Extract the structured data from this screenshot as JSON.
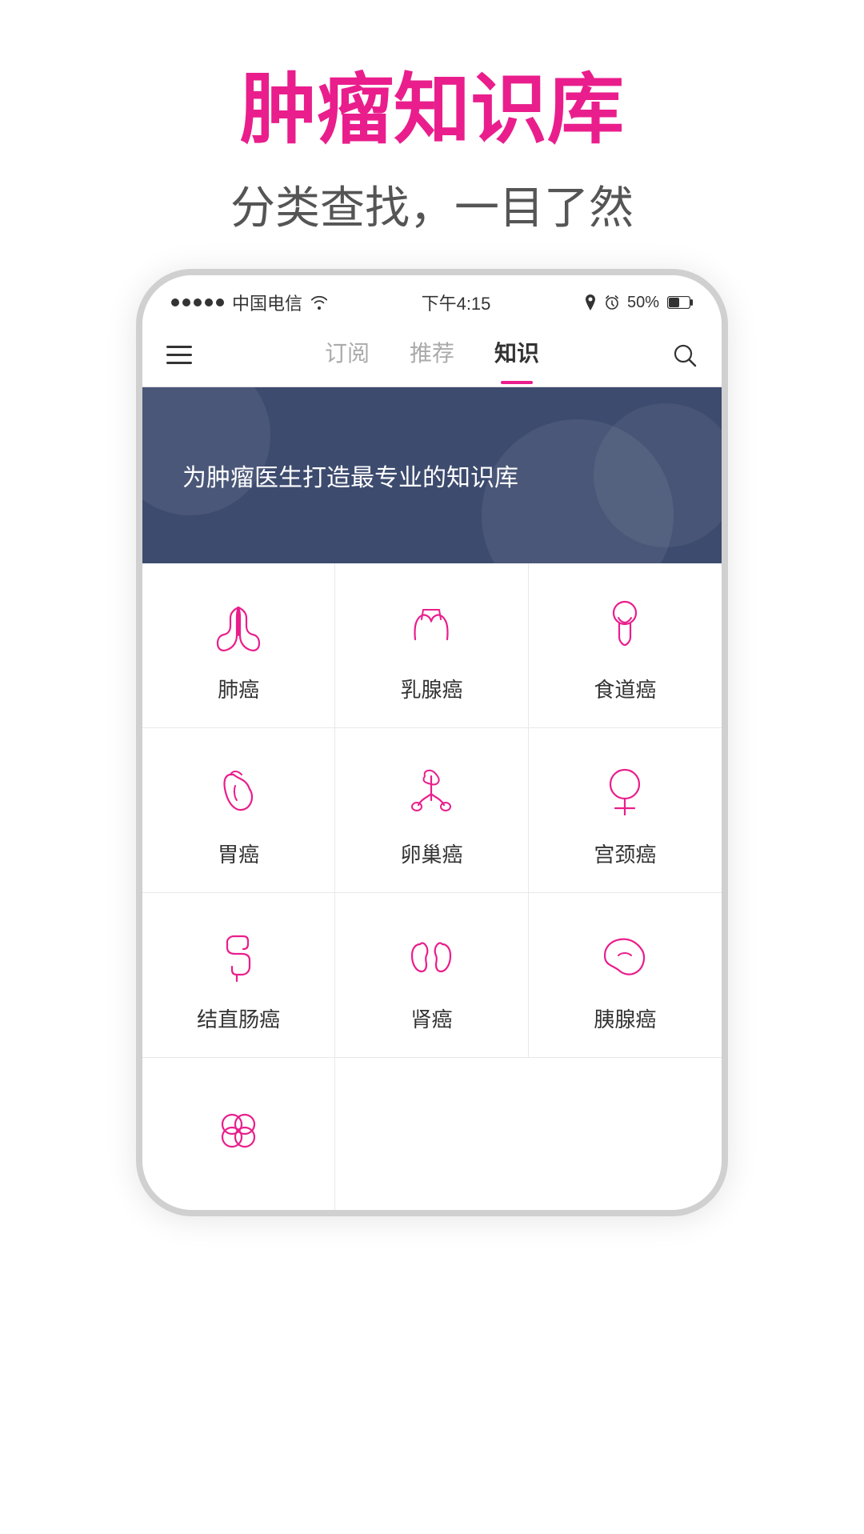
{
  "page": {
    "title_main": "肿瘤知识库",
    "title_sub": "分类查找，一目了然"
  },
  "status_bar": {
    "carrier": "中国电信",
    "time": "下午4:15",
    "battery": "50%"
  },
  "nav": {
    "tabs": [
      {
        "label": "订阅",
        "active": false
      },
      {
        "label": "推荐",
        "active": false
      },
      {
        "label": "知识",
        "active": true
      }
    ]
  },
  "banner": {
    "text": "为肿瘤医生打造最专业的知识库"
  },
  "cancer_types": [
    {
      "label": "肺癌",
      "icon": "lung"
    },
    {
      "label": "乳腺癌",
      "icon": "breast"
    },
    {
      "label": "食道癌",
      "icon": "esophagus"
    },
    {
      "label": "胃癌",
      "icon": "stomach"
    },
    {
      "label": "卵巢癌",
      "icon": "ovary"
    },
    {
      "label": "宫颈癌",
      "icon": "uterus"
    },
    {
      "label": "结直肠癌",
      "icon": "colon"
    },
    {
      "label": "肾癌",
      "icon": "kidney"
    },
    {
      "label": "胰腺癌",
      "icon": "pancreas"
    },
    {
      "label": "",
      "icon": "other"
    }
  ],
  "colors": {
    "pink": "#e91e8c",
    "banner_bg": "#3d4b6e"
  }
}
